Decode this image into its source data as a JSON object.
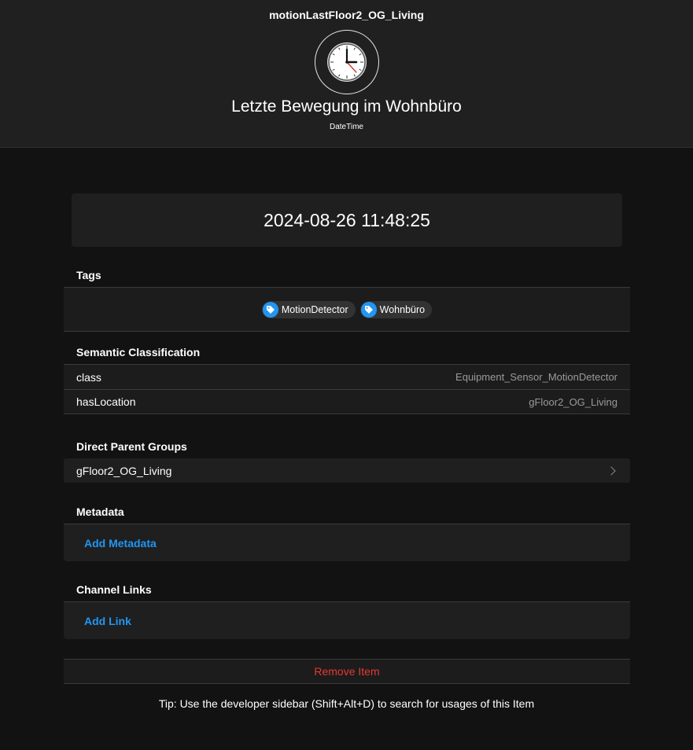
{
  "header": {
    "item_name": "motionLastFloor2_OG_Living",
    "icon": "clock-icon",
    "label": "Letzte Bewegung im Wohnbüro",
    "type": "DateTime"
  },
  "state": {
    "value": "2024-08-26 11:48:25"
  },
  "tags": {
    "title": "Tags",
    "items": [
      {
        "label": "MotionDetector",
        "icon": "tag-icon"
      },
      {
        "label": "Wohnbüro",
        "icon": "tag-icon"
      }
    ]
  },
  "semantic": {
    "title": "Semantic Classification",
    "rows": [
      {
        "key": "class",
        "value": "Equipment_Sensor_MotionDetector"
      },
      {
        "key": "hasLocation",
        "value": "gFloor2_OG_Living"
      }
    ]
  },
  "parent_groups": {
    "title": "Direct Parent Groups",
    "items": [
      {
        "label": "gFloor2_OG_Living"
      }
    ]
  },
  "metadata": {
    "title": "Metadata",
    "add_label": "Add Metadata"
  },
  "channel_links": {
    "title": "Channel Links",
    "add_label": "Add Link"
  },
  "remove": {
    "label": "Remove Item"
  },
  "tip": {
    "text": "Tip: Use the developer sidebar (Shift+Alt+D) to search for usages of this Item"
  },
  "colors": {
    "accent": "#2196f3",
    "danger": "#e53935",
    "background": "#121212",
    "header": "#202020"
  }
}
